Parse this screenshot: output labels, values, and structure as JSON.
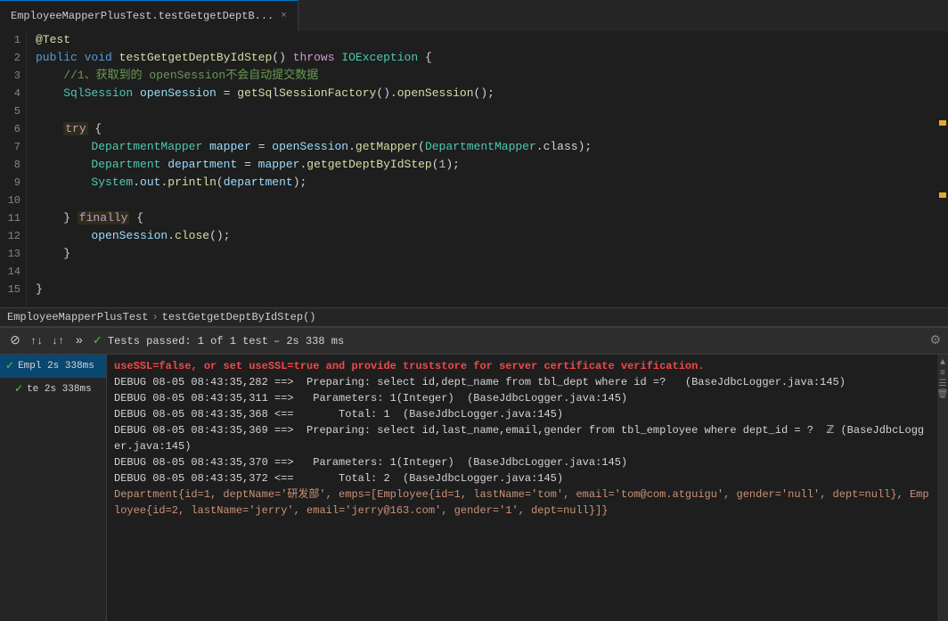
{
  "editor": {
    "lines": [
      {
        "num": "1",
        "content": "@Test",
        "type": "annotation"
      },
      {
        "num": "2",
        "content": "public void testGetgetDeptByIdStep() throws IOException {",
        "type": "code"
      },
      {
        "num": "3",
        "content": "    //1、获取到的 openSession不会自动提交数据",
        "type": "comment"
      },
      {
        "num": "4",
        "content": "    SqlSession openSession = getSqlSessionFactory().openSession();",
        "type": "code"
      },
      {
        "num": "5",
        "content": "",
        "type": "empty"
      },
      {
        "num": "6",
        "content": "    try {",
        "type": "try"
      },
      {
        "num": "7",
        "content": "        DepartmentMapper mapper = openSession.getMapper(DepartmentMapper.class);",
        "type": "code"
      },
      {
        "num": "8",
        "content": "        Department department = mapper.getgetDeptByIdStep(1);",
        "type": "code"
      },
      {
        "num": "9",
        "content": "        System.out.println(department);",
        "type": "code"
      },
      {
        "num": "10",
        "content": "",
        "type": "empty"
      },
      {
        "num": "11",
        "content": "    } finally {",
        "type": "try"
      },
      {
        "num": "12",
        "content": "        openSession.close();",
        "type": "code"
      },
      {
        "num": "13",
        "content": "    }",
        "type": "code"
      },
      {
        "num": "14",
        "content": "",
        "type": "empty"
      },
      {
        "num": "15",
        "content": "}",
        "type": "code"
      }
    ]
  },
  "breadcrumb": {
    "class_name": "EmployeeMapperPlusTest",
    "sep": " › ",
    "method_name": "testGetgetDeptByIdStep()"
  },
  "tab_bar": {
    "tab_label": "EmployeeMapperPlusTest.testGetgetDeptB...",
    "close_symbol": "×"
  },
  "run_toolbar": {
    "tests_passed": "Tests passed: 1 of 1 test",
    "duration": "– 2s 338 ms",
    "gear_symbol": "⚙",
    "sort_asc": "↑",
    "sort_desc": "↓",
    "more": "»",
    "stop": "⊘"
  },
  "test_tree": {
    "items": [
      {
        "label": "Empl 2s 338ms",
        "status": "pass",
        "indent": 0
      },
      {
        "label": "te 2s 338ms",
        "status": "pass",
        "indent": 1
      }
    ]
  },
  "logs": [
    {
      "text": "useSSL=false, or set useSSL=true and provide truststore for server certificate verification.",
      "type": "error"
    },
    {
      "text": "DEBUG 08-05 08:43:35,282 ==>  Preparing: select id,dept_name from tbl_dept where id =?   (BaseJdbcLogger.java:145)",
      "type": "debug"
    },
    {
      "text": "DEBUG 08-05 08:43:35,311 ==>   Parameters: 1(Integer)  (BaseJdbcLogger.java:145)",
      "type": "debug"
    },
    {
      "text": "DEBUG 08-05 08:43:35,368 <==       Total: 1  (BaseJdbcLogger.java:145)",
      "type": "debug"
    },
    {
      "text": "DEBUG 08-05 08:43:35,369 ==>  Preparing: select id,last_name,email,gender from tbl_employee where dept_id = ?  ℤ (BaseJdbcLogger.java:145)",
      "type": "debug"
    },
    {
      "text": "DEBUG 08-05 08:43:35,370 ==>   Parameters: 1(Integer)  (BaseJdbcLogger.java:145)",
      "type": "debug"
    },
    {
      "text": "DEBUG 08-05 08:43:35,372 <==       Total: 2  (BaseJdbcLogger.java:145)",
      "type": "debug"
    },
    {
      "text": "Department{id=1, deptName='研发部', emps=[Employee{id=1, lastName='tom', email='tom@com.atguigu', gender='null', dept=null}, Employee{id=2, lastName='jerry', email='jerry@163.com', gender='1', dept=null}]}",
      "type": "result"
    }
  ]
}
